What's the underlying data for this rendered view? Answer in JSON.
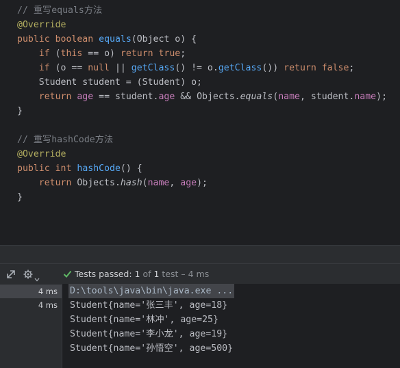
{
  "editor": {
    "lines": [
      [
        {
          "t": "// 重写equals方法",
          "c": "comment"
        }
      ],
      [
        {
          "t": "@Override",
          "c": "anno"
        }
      ],
      [
        {
          "t": "public",
          "c": "kw"
        },
        {
          "t": " "
        },
        {
          "t": "boolean",
          "c": "kw"
        },
        {
          "t": " "
        },
        {
          "t": "equals",
          "c": "fn"
        },
        {
          "t": "("
        },
        {
          "t": "Object",
          "c": "type"
        },
        {
          "t": " o) {"
        }
      ],
      [
        {
          "t": "    "
        },
        {
          "t": "if",
          "c": "kw"
        },
        {
          "t": " ("
        },
        {
          "t": "this",
          "c": "kw"
        },
        {
          "t": " == o) "
        },
        {
          "t": "return",
          "c": "kw"
        },
        {
          "t": " "
        },
        {
          "t": "true",
          "c": "kw"
        },
        {
          "t": ";"
        }
      ],
      [
        {
          "t": "    "
        },
        {
          "t": "if",
          "c": "kw"
        },
        {
          "t": " (o == "
        },
        {
          "t": "null",
          "c": "kw"
        },
        {
          "t": " || "
        },
        {
          "t": "getClass",
          "c": "fn"
        },
        {
          "t": "() != o."
        },
        {
          "t": "getClass",
          "c": "fn"
        },
        {
          "t": "()) "
        },
        {
          "t": "return",
          "c": "kw"
        },
        {
          "t": " "
        },
        {
          "t": "false",
          "c": "kw"
        },
        {
          "t": ";"
        }
      ],
      [
        {
          "t": "    "
        },
        {
          "t": "Student",
          "c": "type"
        },
        {
          "t": " student = ("
        },
        {
          "t": "Student",
          "c": "type"
        },
        {
          "t": ") o;"
        }
      ],
      [
        {
          "t": "    "
        },
        {
          "t": "return",
          "c": "kw"
        },
        {
          "t": " "
        },
        {
          "t": "age",
          "c": "field"
        },
        {
          "t": " == student."
        },
        {
          "t": "age",
          "c": "field"
        },
        {
          "t": " && "
        },
        {
          "t": "Objects",
          "c": "type"
        },
        {
          "t": "."
        },
        {
          "t": "equals",
          "c": "italic"
        },
        {
          "t": "("
        },
        {
          "t": "name",
          "c": "field"
        },
        {
          "t": ", student."
        },
        {
          "t": "name",
          "c": "field"
        },
        {
          "t": ");"
        }
      ],
      [
        {
          "t": "}"
        }
      ],
      [],
      [
        {
          "t": "// 重写hashCode方法",
          "c": "comment"
        }
      ],
      [
        {
          "t": "@Override",
          "c": "anno"
        }
      ],
      [
        {
          "t": "public",
          "c": "kw"
        },
        {
          "t": " "
        },
        {
          "t": "int",
          "c": "kw"
        },
        {
          "t": " "
        },
        {
          "t": "hashCode",
          "c": "fn"
        },
        {
          "t": "() {"
        }
      ],
      [
        {
          "t": "    "
        },
        {
          "t": "return",
          "c": "kw"
        },
        {
          "t": " "
        },
        {
          "t": "Objects",
          "c": "type"
        },
        {
          "t": "."
        },
        {
          "t": "hash",
          "c": "italic"
        },
        {
          "t": "("
        },
        {
          "t": "name",
          "c": "field"
        },
        {
          "t": ", "
        },
        {
          "t": "age",
          "c": "field"
        },
        {
          "t": ");"
        }
      ],
      [
        {
          "t": "}"
        }
      ]
    ]
  },
  "run": {
    "status_prefix": "Tests passed: ",
    "passed": "1",
    "of_text": " of ",
    "total": "1",
    "suffix": " test – 4 ms",
    "icons": [
      "expand-icon",
      "gear-icon",
      "check-icon"
    ]
  },
  "tree": {
    "rows": [
      {
        "time": "4 ms",
        "selected": true
      },
      {
        "time": "4 ms",
        "selected": false
      }
    ]
  },
  "console": {
    "command": "D:\\tools\\java\\bin\\java.exe ...",
    "output": [
      "Student{name='张三丰', age=18}",
      "Student{name='林冲', age=25}",
      "Student{name='李小龙', age=19}",
      "Student{name='孙悟空', age=500}"
    ]
  },
  "colors": {
    "editor_bg": "#1e1f22",
    "keyword": "#cf8e6d",
    "function": "#56a8f5",
    "field": "#c77dbb",
    "annotation": "#b3ae60",
    "comment": "#7a7e85",
    "success": "#5fb865"
  }
}
